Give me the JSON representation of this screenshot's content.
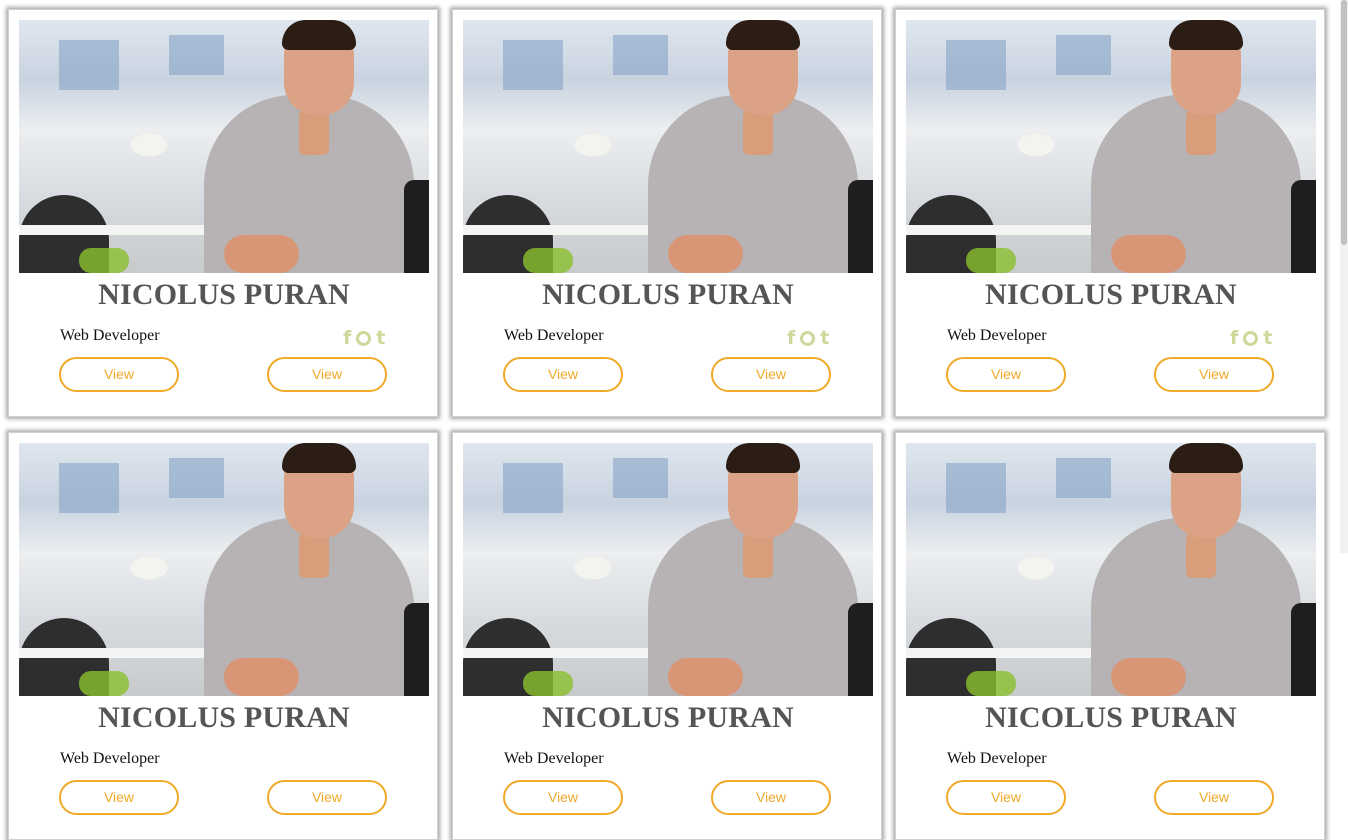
{
  "cards": [
    {
      "name": "NICOLUS PURAN",
      "role": "Web Developer",
      "view_left": "View",
      "view_right": "View"
    },
    {
      "name": "NICOLUS PURAN",
      "role": "Web Developer",
      "view_left": "View",
      "view_right": "View"
    },
    {
      "name": "NICOLUS PURAN",
      "role": "Web Developer",
      "view_left": "View",
      "view_right": "View"
    },
    {
      "name": "NICOLUS PURAN",
      "role": "Web Developer",
      "view_left": "View",
      "view_right": "View"
    },
    {
      "name": "NICOLUS PURAN",
      "role": "Web Developer",
      "view_left": "View",
      "view_right": "View"
    },
    {
      "name": "NICOLUS PURAN",
      "role": "Web Developer",
      "view_left": "View",
      "view_right": "View"
    }
  ],
  "social_icons": [
    "facebook-icon",
    "github-icon",
    "tumblr-icon"
  ],
  "social_glyphs": {
    "facebook": "f",
    "tumblr": "t"
  },
  "colors": {
    "accent": "#f0a928",
    "social": "#cdd99a",
    "name": "#555555"
  }
}
